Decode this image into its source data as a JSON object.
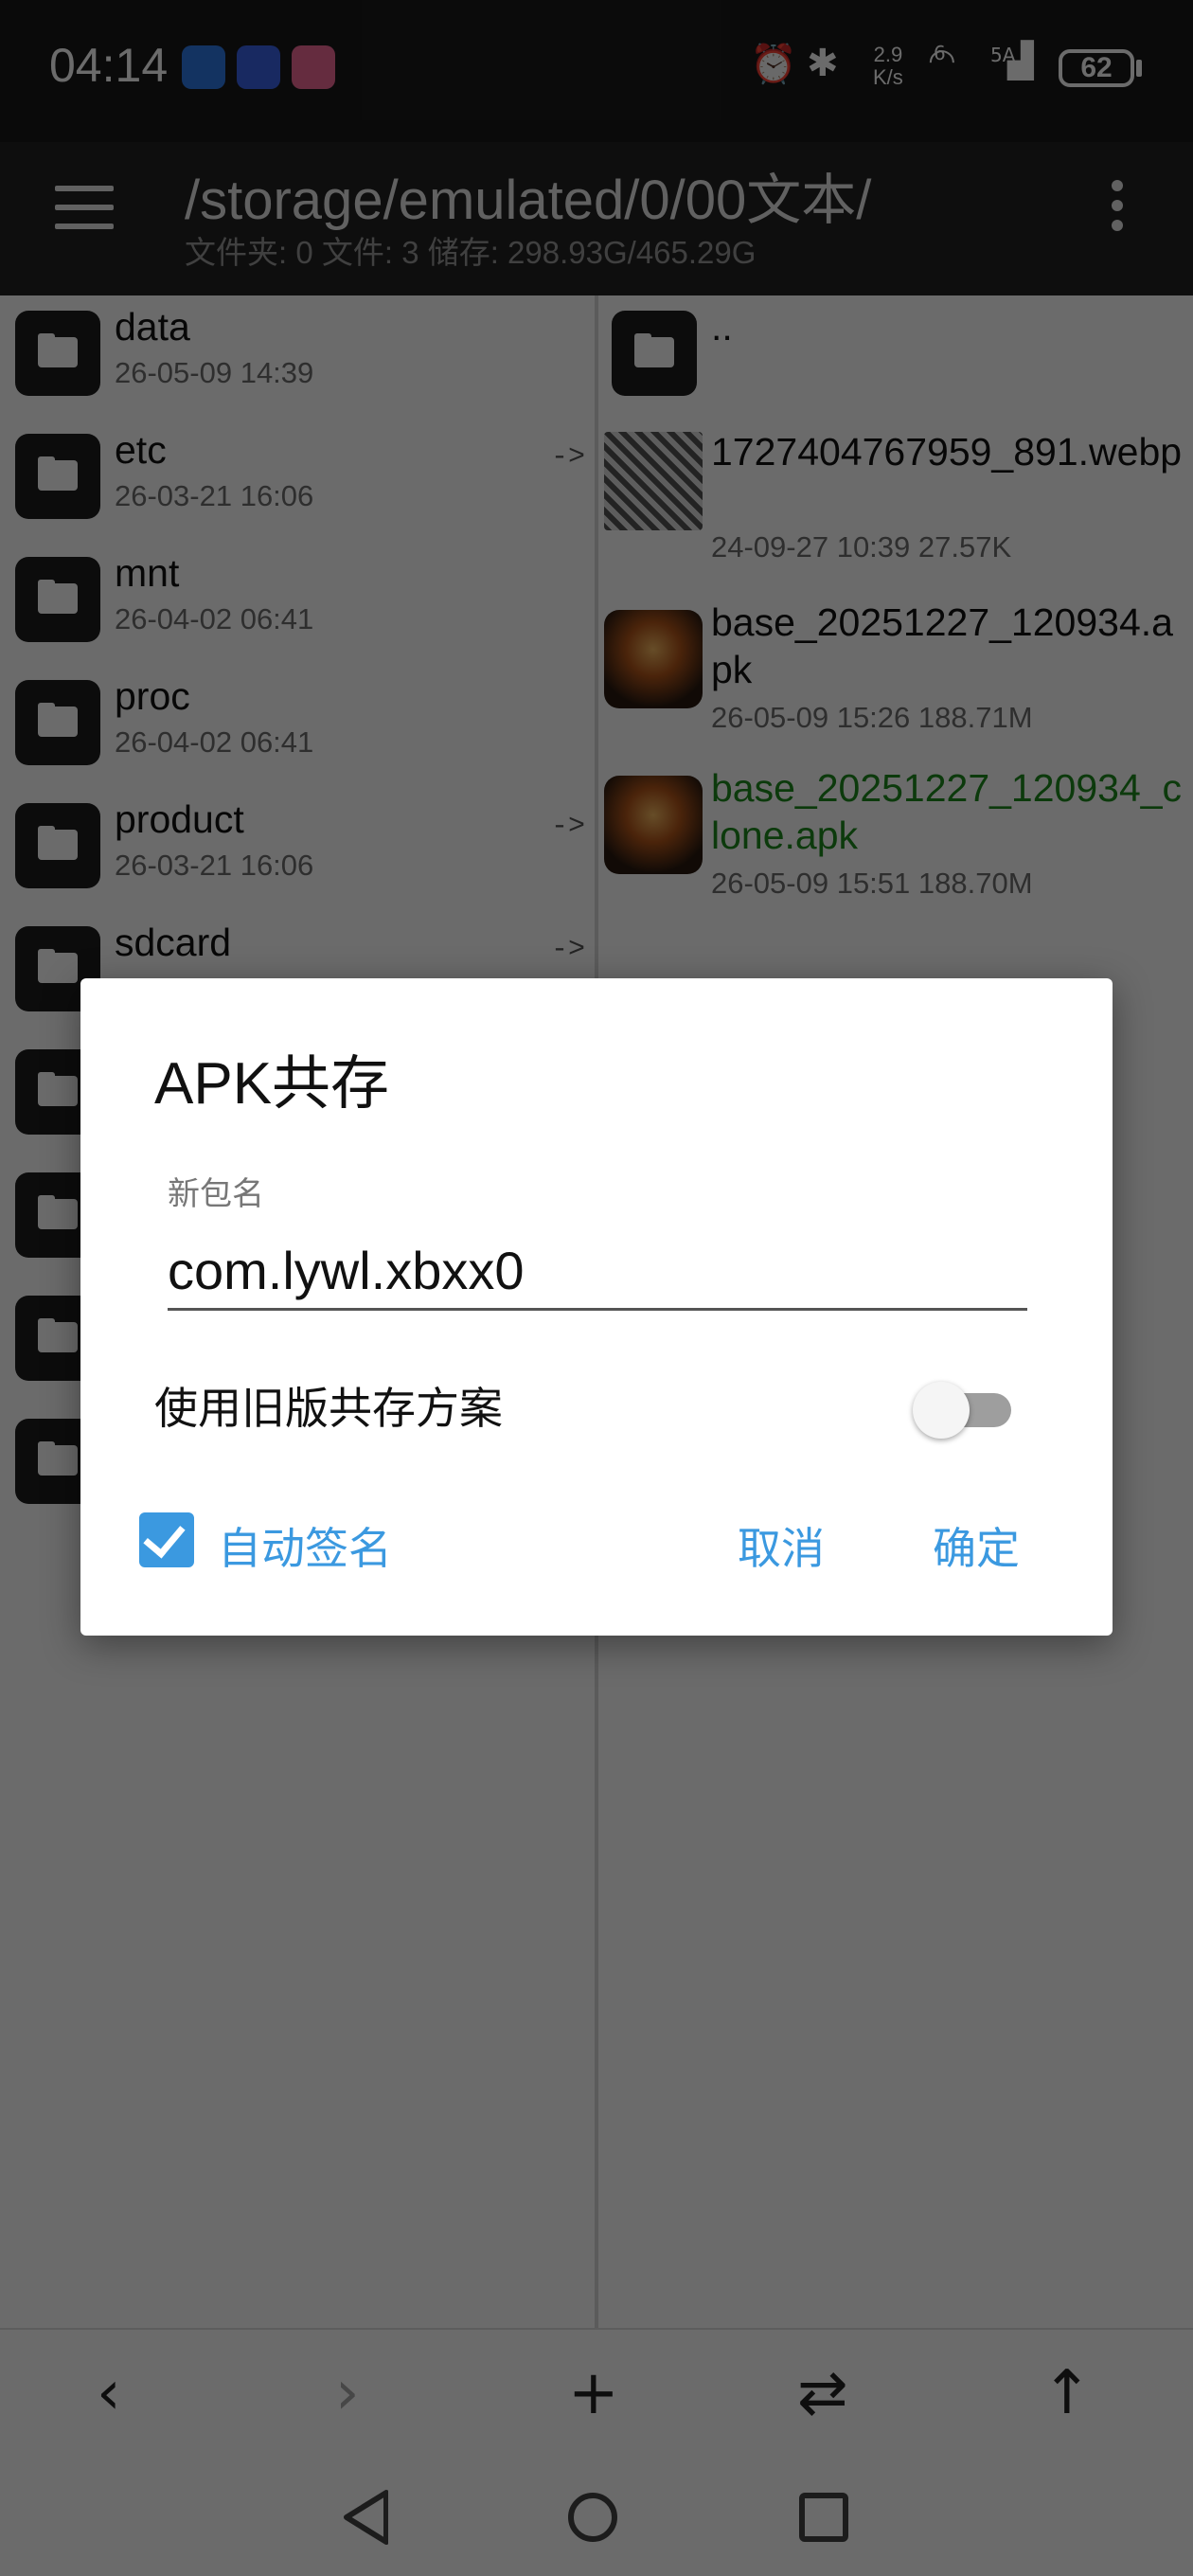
{
  "status_bar": {
    "time": "04:14",
    "net_speed_value": "2.9",
    "net_speed_unit": "K/s",
    "network_label": "6",
    "signal_label": "5A",
    "battery": "62"
  },
  "app_bar": {
    "path": "/storage/emulated/0/00文本/",
    "stats": "文件夹: 0  文件: 3  储存: 298.93G/465.29G"
  },
  "left_pane": {
    "items": [
      {
        "name": "data",
        "date": "26-05-09 14:39",
        "link": ""
      },
      {
        "name": "etc",
        "date": "26-03-21 16:06",
        "link": "->"
      },
      {
        "name": "mnt",
        "date": "26-04-02 06:41",
        "link": ""
      },
      {
        "name": "proc",
        "date": "26-04-02 06:41",
        "link": ""
      },
      {
        "name": "product",
        "date": "26-03-21 16:06",
        "link": "->"
      },
      {
        "name": "sdcard",
        "date": "",
        "link": "->"
      }
    ]
  },
  "right_pane": {
    "parent": "..",
    "items": [
      {
        "name": "1727404767959_891.webp",
        "meta": "24-09-27 10:39  27.57K",
        "color": "#111111"
      },
      {
        "name": "base_20251227_120934.apk",
        "meta": "26-05-09 15:26  188.71M",
        "color": "#111111"
      },
      {
        "name": "base_20251227_120934_clone.apk",
        "meta": "26-05-09 15:51  188.70M",
        "color": "#1e8a1e"
      }
    ]
  },
  "dialog": {
    "title": "APK共存",
    "field_label": "新包名",
    "field_value": "com.lywl.xbxx0",
    "toggle_label": "使用旧版共存方案",
    "toggle_on": false,
    "checkbox_label": "自动签名",
    "checkbox_checked": true,
    "cancel_label": "取消",
    "confirm_label": "确定"
  },
  "bottom_bar": {
    "back": "‹",
    "forward": "›",
    "add": "+",
    "swap": "⇄",
    "up": "↑"
  },
  "colors": {
    "accent": "#3b99e0",
    "highlight_file": "#1e8a1e",
    "scrim": "rgba(0,0,0,0.58)"
  }
}
